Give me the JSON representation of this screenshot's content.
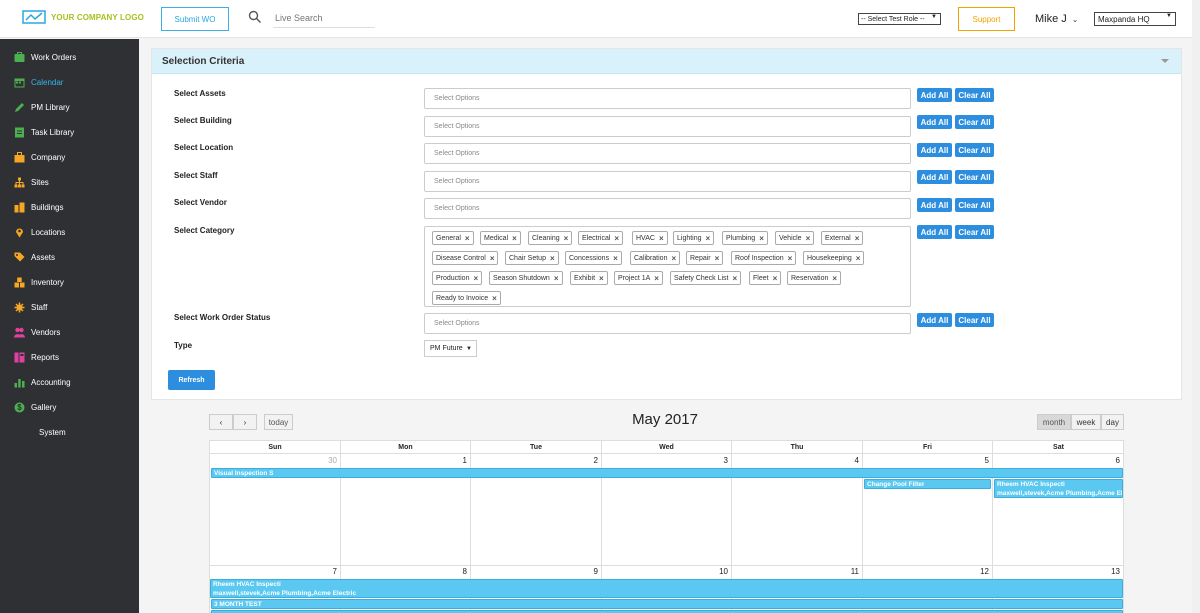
{
  "header": {
    "logo_text": "YOUR COMPANY LOGO",
    "submit_wo_label": "Submit WO",
    "search_placeholder": "Live Search",
    "role_select_value": "-- Select Test Role --",
    "support_label": "Support",
    "user_name": "Mike J",
    "location_select_value": "Maxpanda HQ"
  },
  "sidebar": {
    "items": [
      {
        "label": "Work Orders",
        "icon": "work-orders-icon",
        "color": "#4caf50"
      },
      {
        "label": "Calendar",
        "icon": "calendar-icon",
        "color": "#4caf50",
        "active": true
      },
      {
        "label": "PM Library",
        "icon": "pencil-icon",
        "color": "#4caf50"
      },
      {
        "label": "Task Library",
        "icon": "task-icon",
        "color": "#4caf50"
      },
      {
        "label": "Company",
        "icon": "company-icon",
        "color": "#f5a623"
      },
      {
        "label": "Sites",
        "icon": "sitemap-icon",
        "color": "#f5a623"
      },
      {
        "label": "Buildings",
        "icon": "buildings-icon",
        "color": "#f5a623"
      },
      {
        "label": "Locations",
        "icon": "location-pin-icon",
        "color": "#f5a623"
      },
      {
        "label": "Assets",
        "icon": "tag-icon",
        "color": "#f5a623"
      },
      {
        "label": "Inventory",
        "icon": "inventory-icon",
        "color": "#f5a623"
      },
      {
        "label": "Staff",
        "icon": "staff-icon",
        "color": "#e040a0"
      },
      {
        "label": "Vendors",
        "icon": "vendors-icon",
        "color": "#e040a0"
      },
      {
        "label": "Reports",
        "icon": "reports-icon",
        "color": "#4caf50"
      },
      {
        "label": "Accounting",
        "icon": "accounting-icon",
        "color": "#4caf50"
      },
      {
        "label": "Gallery",
        "icon": "gallery-icon",
        "color": "#2aa7df"
      },
      {
        "label": "System",
        "icon": "",
        "color": ""
      }
    ]
  },
  "selection": {
    "title": "Selection Criteria",
    "placeholder": "Select Options",
    "add_all": "Add All",
    "clear_all": "Clear All",
    "rows": {
      "assets": "Select Assets",
      "building": "Select Building",
      "location": "Select Location",
      "staff": "Select Staff",
      "vendor": "Select Vendor",
      "category": "Select Category",
      "wo_status": "Select Work Order Status",
      "type": "Type"
    },
    "categories": [
      "General",
      "Medical",
      "Cleaning",
      "Electrical",
      "HVAC",
      "Lighting",
      "Plumbing",
      "Vehicle",
      "External",
      "Disease Control",
      "Chair Setup",
      "Concessions",
      "Calibration",
      "Repair",
      "Roof Inspection",
      "Housekeeping",
      "Production",
      "Season Shutdown",
      "Exhibit",
      "Project 1A",
      "Safety Check List",
      "Fleet",
      "Reservation",
      "Ready to Invoice"
    ],
    "type_value": "PM Future",
    "refresh_label": "Refresh"
  },
  "calendar": {
    "title": "May 2017",
    "today_label": "today",
    "prev_label": "‹",
    "next_label": "›",
    "views": [
      "month",
      "week",
      "day"
    ],
    "active_view": "month",
    "days": [
      "Sun",
      "Mon",
      "Tue",
      "Wed",
      "Thu",
      "Fri",
      "Sat"
    ],
    "week1_dates": [
      "30",
      "1",
      "2",
      "3",
      "4",
      "5",
      "6"
    ],
    "week2_dates": [
      "7",
      "8",
      "9",
      "10",
      "11",
      "12",
      "13"
    ],
    "events": {
      "visual_inspection": "Visual Inspection S",
      "change_pool_filter": "Change Pool Filter",
      "rheem_sat_title": "Rheem HVAC Inspecti",
      "rheem_sat_sub": "maxwell,stevek,Acme Plumbing,Acme Ele",
      "rheem_wk2_title": "Rheem HVAC Inspecti",
      "rheem_wk2_sub": "maxwell,stevek,Acme Plumbing,Acme Electric",
      "three_month": "3 MONTH TEST"
    }
  }
}
